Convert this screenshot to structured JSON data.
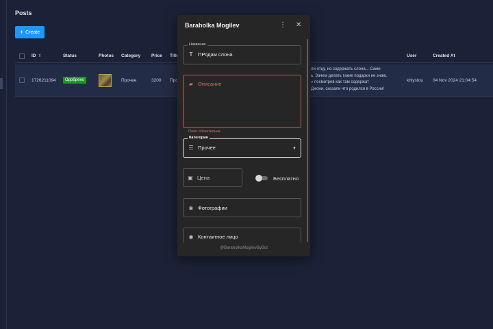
{
  "page": {
    "title": "Posts",
    "create_label": "Create"
  },
  "table": {
    "columns": [
      "ID",
      "Status",
      "Photos",
      "Category",
      "Price",
      "Title",
      "User",
      "Created At"
    ],
    "row": {
      "id": "1726211094",
      "status": "Одобрено",
      "category": "Прочее",
      "price": "3200",
      "title_fragment": "Про",
      "description_lines": [
        "ли отцу, но содержать слона... Сами",
        "ь. Зачем делать такие подарки не знаю.",
        "» посмотрев как там содержат",
        "Джони, сказали что родился в России!"
      ],
      "user": "khlystou",
      "created_at": "04 Nov 2024 21:04:54"
    }
  },
  "modal": {
    "title": "Baraholka Mogilev",
    "fields": {
      "name": {
        "legend": "Название",
        "value": "ПРодам слона"
      },
      "description": {
        "placeholder": "Описание",
        "error": "Поле обязательна"
      },
      "category": {
        "legend": "Категория",
        "value": "Прочее"
      },
      "price": {
        "placeholder": "Цена"
      },
      "free_toggle_label": "Бесплатно",
      "photos": {
        "label": "Фотографии"
      },
      "contact": {
        "label": "Контактное лицо"
      }
    },
    "footer": "@BaraholkaMogilevByBot"
  },
  "colors": {
    "background": "#1b2238",
    "modal": "#262626",
    "accent": "#2196f3",
    "status_green": "#169a1e",
    "error": "#e06a6a"
  },
  "icons": {
    "create": "plus-icon",
    "more": "more-vertical-icon",
    "close": "close-icon",
    "name": "text-t-icon",
    "description": "comment-icon",
    "category": "list-icon",
    "price": "money-icon",
    "photos": "camera-icon",
    "contact": "account-circle-icon"
  }
}
